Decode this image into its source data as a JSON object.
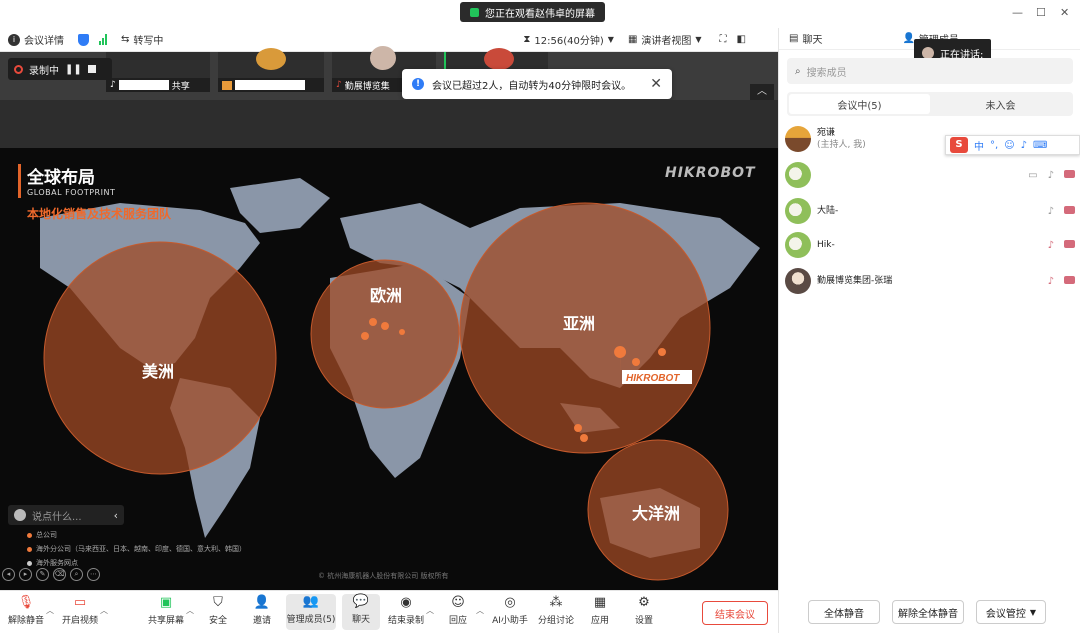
{
  "window": {
    "share_banner": "您正在观看赵伟卓的屏幕",
    "controls": [
      "—",
      "☐",
      "✕"
    ]
  },
  "infobar": {
    "details": "会议详情",
    "transcribe": "转写中",
    "timer": "12:56(40分钟)",
    "view": "演讲者视图"
  },
  "strip": {
    "record": "录制中",
    "tile1_suffix": "共享",
    "tile3_name": "勤展博览集"
  },
  "toast": {
    "message": "会议已超过2人，自动转为40分钟限时会议。",
    "close": "✕"
  },
  "slide": {
    "title": "全球布局",
    "subtitle": "GLOBAL FOOTPRINT",
    "tagline": "本地化销售及技术服务团队",
    "brand": "HIKROBOT",
    "brand_pin": "HIKROBOT",
    "continents": {
      "america": "美洲",
      "europe": "欧洲",
      "asia": "亚洲",
      "oceania": "大洋洲"
    },
    "legend": [
      "总公司",
      "海外分公司（马来西亚、日本、越南、印度、德国、意大利、韩国）",
      "海外服务网点"
    ],
    "copyright": "© 杭州海康机器人股份有限公司 版权所有",
    "chat_placeholder": "说点什么...",
    "chat_arrow": "‹",
    "tools": [
      "◂",
      "▸",
      "✎",
      "⌫",
      "⌕",
      "⋯"
    ]
  },
  "toolbar": {
    "buttons": [
      {
        "label": "解除静音",
        "icon": "mic-muted-icon"
      },
      {
        "label": "开启视频",
        "icon": "video-off-icon"
      },
      {
        "label": "共享屏幕",
        "icon": "screen-share-icon"
      },
      {
        "label": "安全",
        "icon": "shield-icon"
      },
      {
        "label": "邀请",
        "icon": "invite-icon"
      },
      {
        "label": "管理成员(5)",
        "icon": "members-icon"
      },
      {
        "label": "聊天",
        "icon": "chat-icon"
      },
      {
        "label": "结束录制",
        "icon": "record-icon"
      },
      {
        "label": "回应",
        "icon": "emoji-icon"
      },
      {
        "label": "AI小助手",
        "icon": "ai-assistant-icon"
      },
      {
        "label": "分组讨论",
        "icon": "breakout-icon"
      },
      {
        "label": "应用",
        "icon": "apps-icon"
      },
      {
        "label": "设置",
        "icon": "gear-icon"
      }
    ],
    "end": "结束会议"
  },
  "panel": {
    "tab_chat": "聊天",
    "tab_members": "管理成员",
    "speaking": "正在讲话:",
    "search_placeholder": "搜索成员",
    "seg_in": "会议中(5)",
    "seg_out": "未入会",
    "members": [
      {
        "name": "宛谦",
        "sub": "(主持人, 我)",
        "avatar": "sunset"
      },
      {
        "name": "",
        "sub": "",
        "avatar": "green"
      },
      {
        "name": "大陆-",
        "sub": "",
        "avatar": "green"
      },
      {
        "name": "Hik-",
        "sub": "",
        "avatar": "green"
      },
      {
        "name": "勤展博览集团-张瑞",
        "sub": "",
        "avatar": "girl"
      }
    ],
    "mute_all": "全体静音",
    "unmute_all": "解除全体静音",
    "control": "会议管控"
  },
  "ime": {
    "s": "S",
    "lang": "中"
  },
  "colors": {
    "accent": "#2f7cf6",
    "danger": "#e84a3c",
    "slide_orange": "#e2642a",
    "circle_fill": "#a04a24"
  }
}
